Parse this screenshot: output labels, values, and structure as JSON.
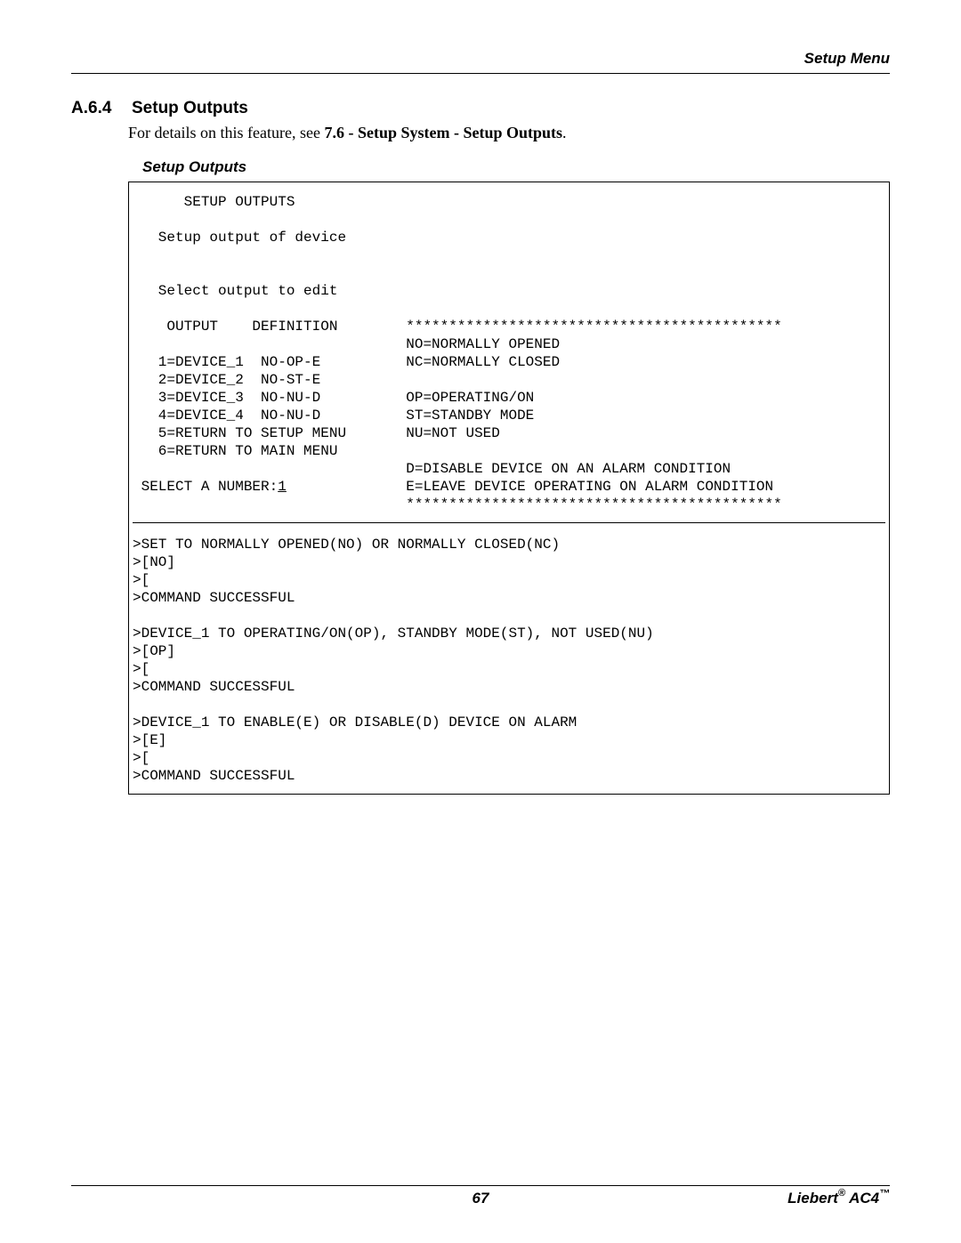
{
  "header": {
    "right": "Setup Menu"
  },
  "section": {
    "number": "A.6.4",
    "title": "Setup Outputs",
    "intro_prefix": "For details on this feature, see ",
    "intro_bold": "7.6 - Setup System - Setup Outputs",
    "intro_suffix": "."
  },
  "subcaption": "Setup Outputs",
  "terminal": {
    "upper_lines": [
      "      SETUP OUTPUTS",
      "",
      "   Setup output of device",
      "",
      "",
      "   Select output to edit",
      "",
      "    OUTPUT    DEFINITION        ********************************************",
      "                                NO=NORMALLY OPENED",
      "   1=DEVICE_1  NO-OP-E          NC=NORMALLY CLOSED",
      "   2=DEVICE_2  NO-ST-E",
      "   3=DEVICE_3  NO-NU-D          OP=OPERATING/ON",
      "   4=DEVICE_4  NO-NU-D          ST=STANDBY MODE",
      "   5=RETURN TO SETUP MENU       NU=NOT USED",
      "   6=RETURN TO MAIN MENU",
      "                                D=DISABLE DEVICE ON AN ALARM CONDITION"
    ],
    "select_prompt_prefix": " SELECT A NUMBER:",
    "select_value": "1",
    "select_suffix": "              E=LEAVE DEVICE OPERATING ON ALARM CONDITION",
    "stars_line": "                                ********************************************",
    "lower_lines": [
      ">SET TO NORMALLY OPENED(NO) OR NORMALLY CLOSED(NC)",
      ">[NO]",
      ">[",
      ">COMMAND SUCCESSFUL",
      "",
      ">DEVICE_1 TO OPERATING/ON(OP), STANDBY MODE(ST), NOT USED(NU)",
      ">[OP]",
      ">[",
      ">COMMAND SUCCESSFUL",
      "",
      ">DEVICE_1 TO ENABLE(E) OR DISABLE(D) DEVICE ON ALARM",
      ">[E]",
      ">[",
      ">COMMAND SUCCESSFUL"
    ]
  },
  "footer": {
    "page_number": "67",
    "brand": "Liebert",
    "reg": "®",
    "model_space": " AC4",
    "tm": "™"
  }
}
